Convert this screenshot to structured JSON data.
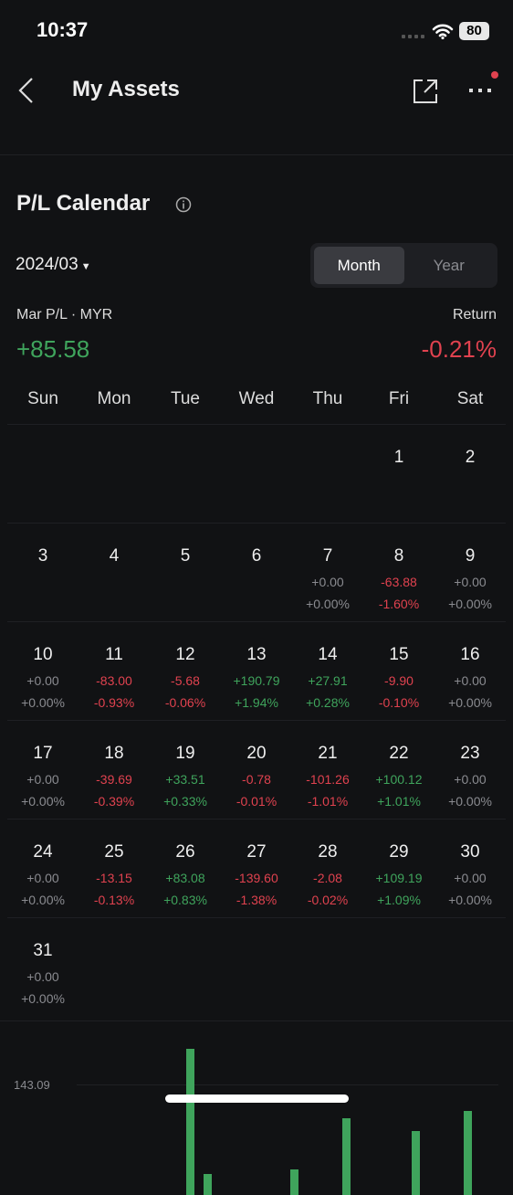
{
  "status": {
    "time": "10:37",
    "battery": "80"
  },
  "header": {
    "title": "My Assets",
    "notification_dot_color": "#e0424f"
  },
  "pl": {
    "title": "P/L Calendar",
    "date": "2024/03",
    "tabs": [
      "Month",
      "Year"
    ],
    "active_tab": "Month",
    "pl_label": "Mar P/L · MYR",
    "pl_value": "+85.58",
    "return_label": "Return",
    "return_value": "-0.21%"
  },
  "weekdays": [
    "Sun",
    "Mon",
    "Tue",
    "Wed",
    "Thu",
    "Fri",
    "Sat"
  ],
  "weeks": [
    [
      null,
      null,
      null,
      null,
      null,
      {
        "d": "1"
      },
      {
        "d": "2"
      }
    ],
    [
      {
        "d": "3"
      },
      {
        "d": "4"
      },
      {
        "d": "5"
      },
      {
        "d": "6"
      },
      {
        "d": "7",
        "v": "+0.00",
        "p": "+0.00%"
      },
      {
        "d": "8",
        "v": "-63.88",
        "p": "-1.60%"
      },
      {
        "d": "9",
        "v": "+0.00",
        "p": "+0.00%"
      }
    ],
    [
      {
        "d": "10",
        "v": "+0.00",
        "p": "+0.00%"
      },
      {
        "d": "11",
        "v": "-83.00",
        "p": "-0.93%"
      },
      {
        "d": "12",
        "v": "-5.68",
        "p": "-0.06%"
      },
      {
        "d": "13",
        "v": "+190.79",
        "p": "+1.94%"
      },
      {
        "d": "14",
        "v": "+27.91",
        "p": "+0.28%"
      },
      {
        "d": "15",
        "v": "-9.90",
        "p": "-0.10%"
      },
      {
        "d": "16",
        "v": "+0.00",
        "p": "+0.00%"
      }
    ],
    [
      {
        "d": "17",
        "v": "+0.00",
        "p": "+0.00%"
      },
      {
        "d": "18",
        "v": "-39.69",
        "p": "-0.39%"
      },
      {
        "d": "19",
        "v": "+33.51",
        "p": "+0.33%"
      },
      {
        "d": "20",
        "v": "-0.78",
        "p": "-0.01%"
      },
      {
        "d": "21",
        "v": "-101.26",
        "p": "-1.01%"
      },
      {
        "d": "22",
        "v": "+100.12",
        "p": "+1.01%"
      },
      {
        "d": "23",
        "v": "+0.00",
        "p": "+0.00%"
      }
    ],
    [
      {
        "d": "24",
        "v": "+0.00",
        "p": "+0.00%"
      },
      {
        "d": "25",
        "v": "-13.15",
        "p": "-0.13%"
      },
      {
        "d": "26",
        "v": "+83.08",
        "p": "+0.83%"
      },
      {
        "d": "27",
        "v": "-139.60",
        "p": "-1.38%"
      },
      {
        "d": "28",
        "v": "-2.08",
        "p": "-0.02%"
      },
      {
        "d": "29",
        "v": "+109.19",
        "p": "+1.09%"
      },
      {
        "d": "30",
        "v": "+0.00",
        "p": "+0.00%"
      }
    ],
    [
      {
        "d": "31",
        "v": "+0.00",
        "p": "+0.00%"
      },
      null,
      null,
      null,
      null,
      null,
      null
    ]
  ],
  "chart": {
    "y_label": "143.09",
    "bar_color": "#3fa45c"
  },
  "colors": {
    "positive": "#3fa45c",
    "negative": "#e0424f",
    "neutral": "#8a8b90",
    "background": "#111214"
  }
}
